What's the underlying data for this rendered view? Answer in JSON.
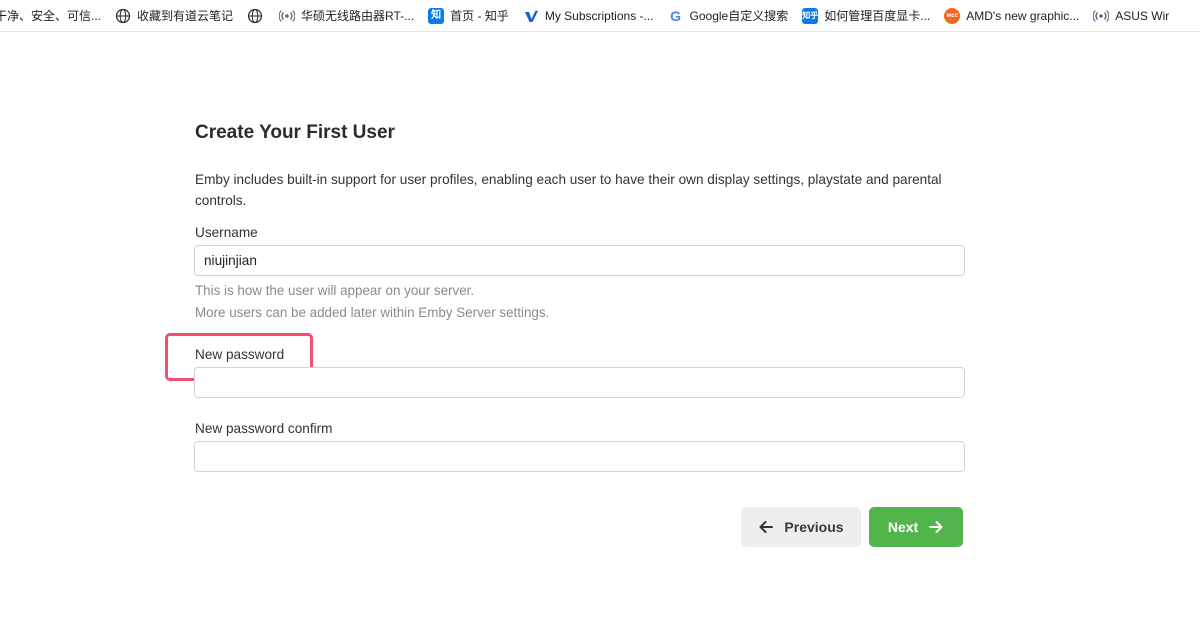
{
  "bookmarks": [
    {
      "label": "干净、安全、可信...",
      "icon": "none"
    },
    {
      "label": "收藏到有道云笔记",
      "icon": "globe-icon"
    },
    {
      "label": "",
      "icon": "globe-icon"
    },
    {
      "label": "华硕无线路由器RT-...",
      "icon": "wifi-icon"
    },
    {
      "label": "首页 - 知乎",
      "icon": "zhihu-icon",
      "glyph": "知"
    },
    {
      "label": "My Subscriptions -...",
      "icon": "vimeo-icon",
      "glyph": "V"
    },
    {
      "label": "Google自定义搜索",
      "icon": "google-icon",
      "glyph": "G"
    },
    {
      "label": "如何管理百度显卡...",
      "icon": "zhihu-icon",
      "glyph": "知乎"
    },
    {
      "label": "AMD's new graphic...",
      "icon": "wccf-icon",
      "glyph": "wcc"
    },
    {
      "label": "ASUS Wir",
      "icon": "wifi-icon"
    }
  ],
  "form": {
    "title": "Create Your First User",
    "intro": "Emby includes built-in support for user profiles, enabling each user to have their own display settings, playstate and parental controls.",
    "username_label": "Username",
    "username_value": "niujinjian",
    "username_help_1": "This is how the user will appear on your server.",
    "username_help_2": "More users can be added later within Emby Server settings.",
    "password_label": "New password",
    "password_value": "",
    "password_confirm_label": "New password confirm",
    "password_confirm_value": ""
  },
  "buttons": {
    "previous_label": "Previous",
    "next_label": "Next"
  },
  "colors": {
    "next_button": "#52b54b",
    "previous_button": "#eeeeee",
    "highlight_box": "#f0506e"
  }
}
